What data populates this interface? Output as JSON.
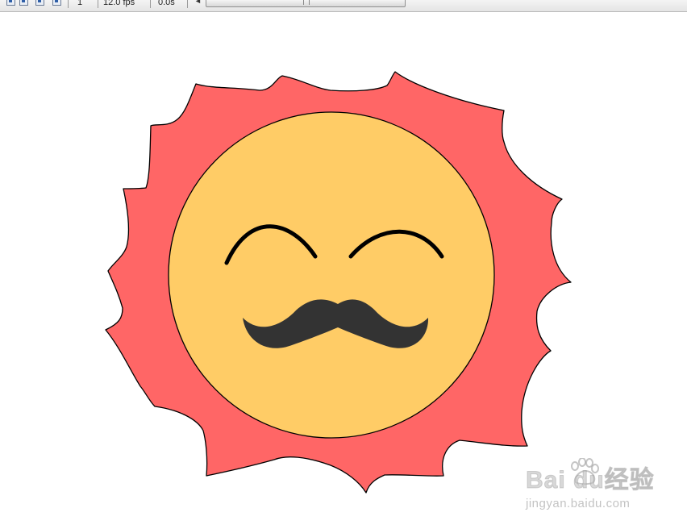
{
  "timeline": {
    "frame_number": "1",
    "frame_rate": "12.0 fps",
    "elapsed_time": "0.0s",
    "tool_icons": [
      "onion-skin-icon",
      "onion-skin-outlines-icon",
      "edit-multiple-frames-icon",
      "modify-onion-markers-icon"
    ]
  },
  "stage": {
    "artwork": "smiling-sun-with-mustache",
    "colors": {
      "rays": "#ff6666",
      "face": "#ffcc66",
      "features": "#333333",
      "eyebrows": "#000000",
      "outline": "#000000"
    }
  },
  "watermark": {
    "logo_text": "Bai du经验",
    "url_text": "jingyan.baidu.com"
  }
}
